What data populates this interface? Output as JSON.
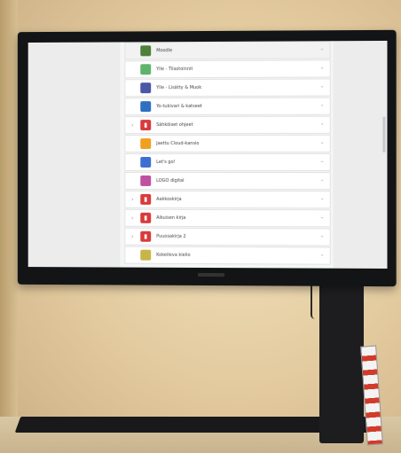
{
  "list": [
    {
      "label": "Moodle",
      "icon": "moodle-icon",
      "color": "#4f7f3a",
      "expander": false
    },
    {
      "label": "Ylle - Tilastoinnit",
      "icon": "shield-icon",
      "color": "#5fb36a",
      "expander": false
    },
    {
      "label": "Ylle - Lisätty & Muok",
      "icon": "shield-icon",
      "color": "#4a56a6",
      "expander": false
    },
    {
      "label": "Yo-tukivari & katseet",
      "icon": "pen-icon",
      "color": "#2e6fc2",
      "expander": false
    },
    {
      "label": "Sähköiset ohjeet",
      "icon": "doc-icon",
      "color": "#d93a3a",
      "expander": true
    },
    {
      "label": "Jaettu Cloud-kansio",
      "icon": "cloud-icon",
      "color": "#f0a020",
      "expander": false
    },
    {
      "label": "Let's go!",
      "icon": "photo-icon",
      "color": "#3d6fd2",
      "expander": false
    },
    {
      "label": "LOGO digital",
      "icon": "logo-icon",
      "color": "#bf4fa0",
      "expander": false
    },
    {
      "label": "Aakkoskirja",
      "icon": "doc-icon",
      "color": "#d93a3a",
      "expander": true
    },
    {
      "label": "Aikuisen kirja",
      "icon": "doc-icon",
      "color": "#d93a3a",
      "expander": true
    },
    {
      "label": "Puuosakirja 2",
      "icon": "doc-icon",
      "color": "#d93a3a",
      "expander": true
    },
    {
      "label": "Kokeileva kielio",
      "icon": "app-icon",
      "color": "#c9b44a",
      "expander": false
    }
  ]
}
